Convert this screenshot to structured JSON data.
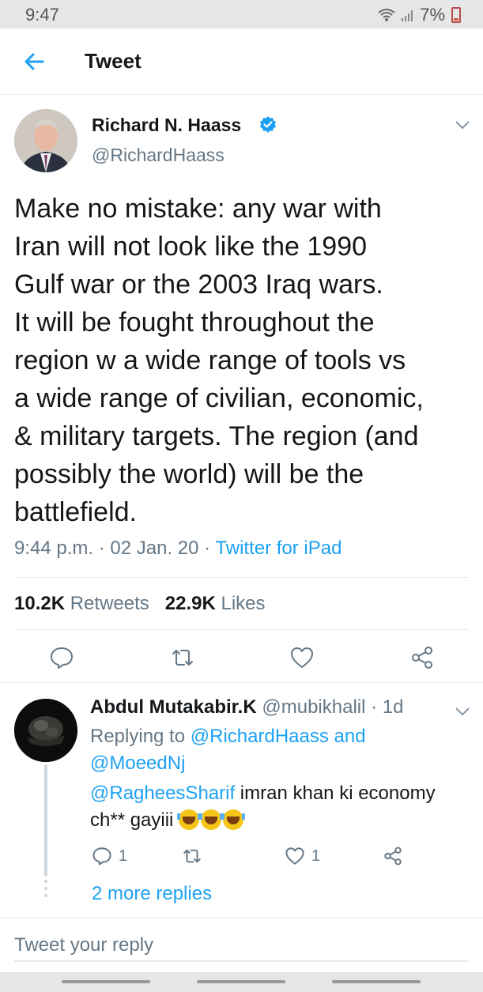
{
  "status_bar": {
    "time": "9:47",
    "battery": "7%"
  },
  "header": {
    "title": "Tweet"
  },
  "tweet": {
    "author_name": "Richard N. Haass",
    "author_handle": "@RichardHaass",
    "text": "Make no mistake:  any war with\nIran will not look like the 1990\nGulf war or the 2003 Iraq wars.\nIt will be fought throughout the\nregion w a wide range of tools vs\na wide range of civilian, economic,\n& military targets. The region (and\npossibly the world) will be the\nbattlefield.",
    "time": "9:44 p.m.",
    "separator": "·",
    "date": "02 Jan. 20",
    "source": "Twitter for iPad",
    "retweets_count": "10.2K",
    "retweets_label": "Retweets",
    "likes_count": "22.9K",
    "likes_label": "Likes"
  },
  "reply": {
    "name": "Abdul Mutakabir.K",
    "handle": "@mubikhalil",
    "age": "· 1d",
    "replying_label": "Replying to",
    "mention_1": "@RichardHaass",
    "and_label": "and",
    "mention_2": "@MoeedNj",
    "text_mention": "@RagheesSharif",
    "text_body": " imran khan ki economy ch** gayiii ",
    "reply_count": "1",
    "like_count": "1",
    "more_replies": "2 more replies"
  },
  "compose": {
    "placeholder": "Tweet your reply"
  },
  "colors": {
    "accent": "#1da1f2",
    "secondary_text": "#657786",
    "border": "#e6ecf0"
  },
  "icons": [
    "back-arrow-icon",
    "verified-badge-icon",
    "chevron-down-icon",
    "reply-icon",
    "retweet-icon",
    "like-icon",
    "share-icon",
    "tears-of-joy-emoji"
  ]
}
